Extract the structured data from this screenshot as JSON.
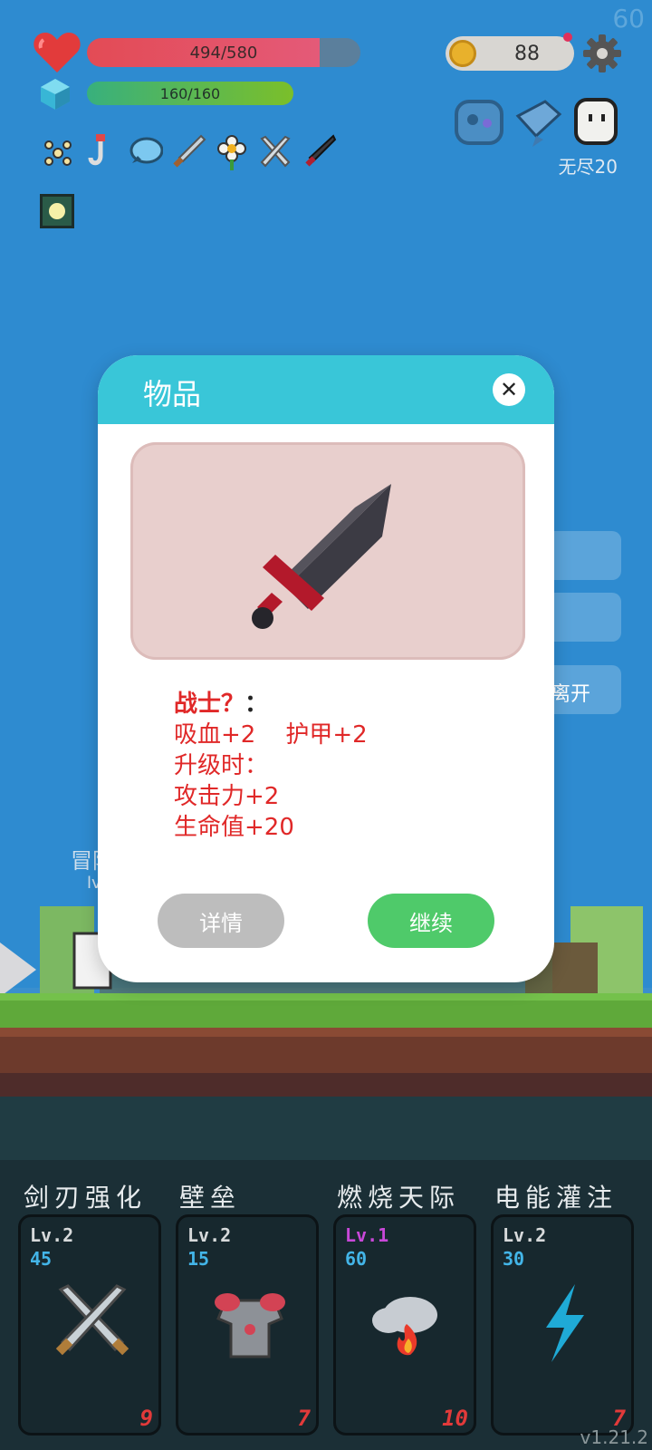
{
  "hud": {
    "fps": "60",
    "hp_text": "494/580",
    "hp_fraction": 0.852,
    "mp_text": "160/160",
    "mp_fraction": 1.0,
    "coins": "88",
    "mode": "无尽20",
    "colors": {
      "hp": "#e34b55",
      "mp": "#7bbf2a",
      "coin": "#e8b12c"
    }
  },
  "buffs": [
    "molecule-icon",
    "hook-icon",
    "speech-bubble-icon",
    "sword-icon",
    "flower-icon",
    "crossed-swords-icon",
    "dark-sword-icon"
  ],
  "side_buttons": {
    "leave_label": "离开"
  },
  "background_texts": {
    "line1": "冒险",
    "line2": "lv"
  },
  "modal": {
    "title": "物品",
    "item_name": "战士？",
    "item_colon": "：",
    "lines": [
      "吸血+2    护甲+2",
      "升级时：",
      "攻击力+2",
      "生命值+20"
    ],
    "details_label": "详情",
    "continue_label": "继续"
  },
  "skills": [
    {
      "title": "剑刃强化",
      "level": "Lv.2",
      "cost": "45",
      "count": "9",
      "level_color": "#d7dadb",
      "icon": "crossed-swords-icon"
    },
    {
      "title": "壁垒",
      "level": "Lv.2",
      "cost": "15",
      "count": "7",
      "level_color": "#d7dadb",
      "icon": "armor-icon"
    },
    {
      "title": "燃烧天际",
      "level": "Lv.1",
      "cost": "60",
      "count": "10",
      "level_color": "#c848d8",
      "icon": "fire-cloud-icon"
    },
    {
      "title": "电能灌注",
      "level": "Lv.2",
      "cost": "30",
      "count": "7",
      "level_color": "#d7dadb",
      "icon": "lightning-icon"
    }
  ],
  "version": "v1.21.2"
}
